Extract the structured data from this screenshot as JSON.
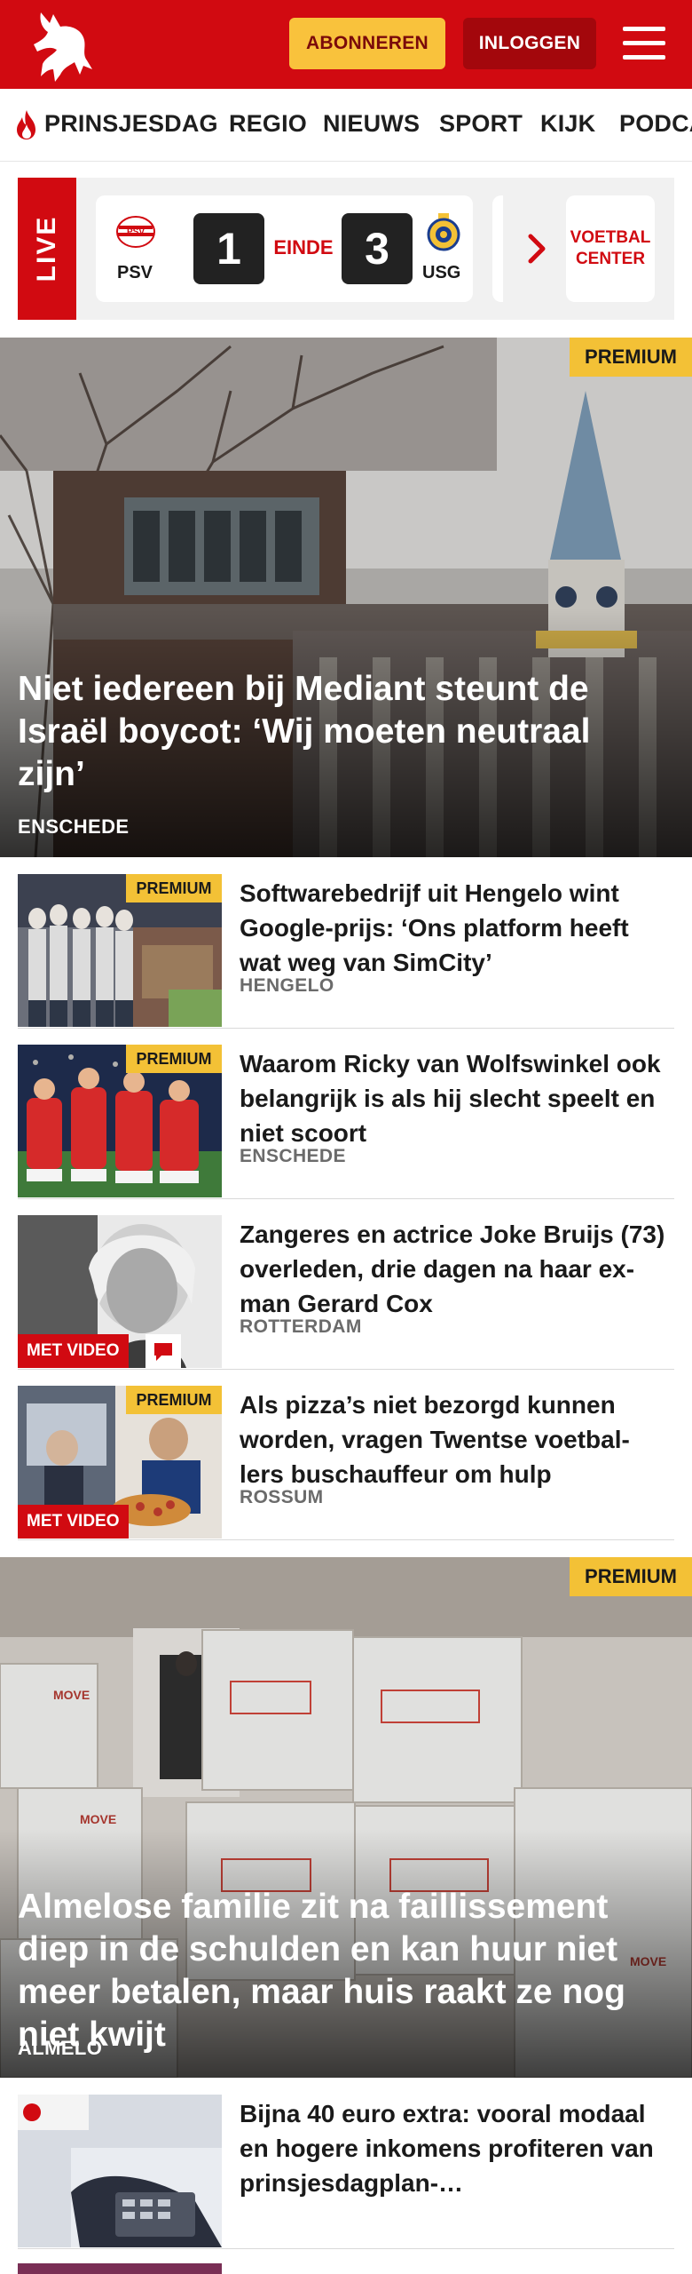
{
  "header": {
    "logo_icon": "tubantia-horse-logo",
    "subscribe_label": "ABONNEREN",
    "login_label": "INLOGGEN",
    "menu_icon": "hamburger-menu-icon",
    "colors": {
      "brand_red": "#d10a11",
      "subscribe_yellow": "#f9c23c",
      "login_dark_red": "#a3070c"
    }
  },
  "nav": {
    "items": [
      {
        "label": "PRINSJESDAG",
        "icon": "flame-icon"
      },
      {
        "label": "REGIO"
      },
      {
        "label": "NIEUWS"
      },
      {
        "label": "SPORT"
      },
      {
        "label": "KIJK"
      },
      {
        "label": "PODCA"
      }
    ]
  },
  "live": {
    "tab_label": "LIVE",
    "match": {
      "home_team": "PSV",
      "home_score": "1",
      "status": "EINDE",
      "away_score": "3",
      "away_team": "USG"
    },
    "voetbal_center_label": "VOETBAL\nCENTER"
  },
  "premium_label": "PREMIUM",
  "video_label": "MET VIDEO",
  "articles": [
    {
      "title": "Niet iedereen bij Mediant steunt de Israël boycot: ‘Wij moeten neutraal zijn’",
      "location": "ENSCHEDE",
      "premium": true
    },
    {
      "title": "Softwarebedrijf uit Hengelo wint Google-prijs: ‘Ons platform heeft wat weg van SimCity’",
      "location": "HENGELO",
      "premium": true
    },
    {
      "title": "Waarom Ricky van Wolfswinkel ook belangrijk is als hij slecht speelt en niet scoort",
      "location": "ENSCHEDE",
      "premium": true
    },
    {
      "title": "Zangeres en actrice Joke Bruijs (73) overleden, drie dagen na haar ex-man Gerard Cox",
      "location": "ROTTERDAM",
      "premium": false,
      "video": true
    },
    {
      "title": "Als pizza’s niet bezorgd kunnen worden, vragen Twentse voetbal­lers buschauffeur om hulp",
      "location": "ROSSUM",
      "premium": true,
      "video": true
    },
    {
      "title": "Almelose familie zit na faillissement diep in de schulden en kan huur niet meer betalen, maar huis raakt ze nog niet kwijt",
      "location": "ALMELO",
      "premium": true
    },
    {
      "title": "Bijna 40 euro extra: vooral modaal en hogere inkomens profiteren van prinsjesdagplan-…",
      "location": "",
      "premium": false
    }
  ]
}
